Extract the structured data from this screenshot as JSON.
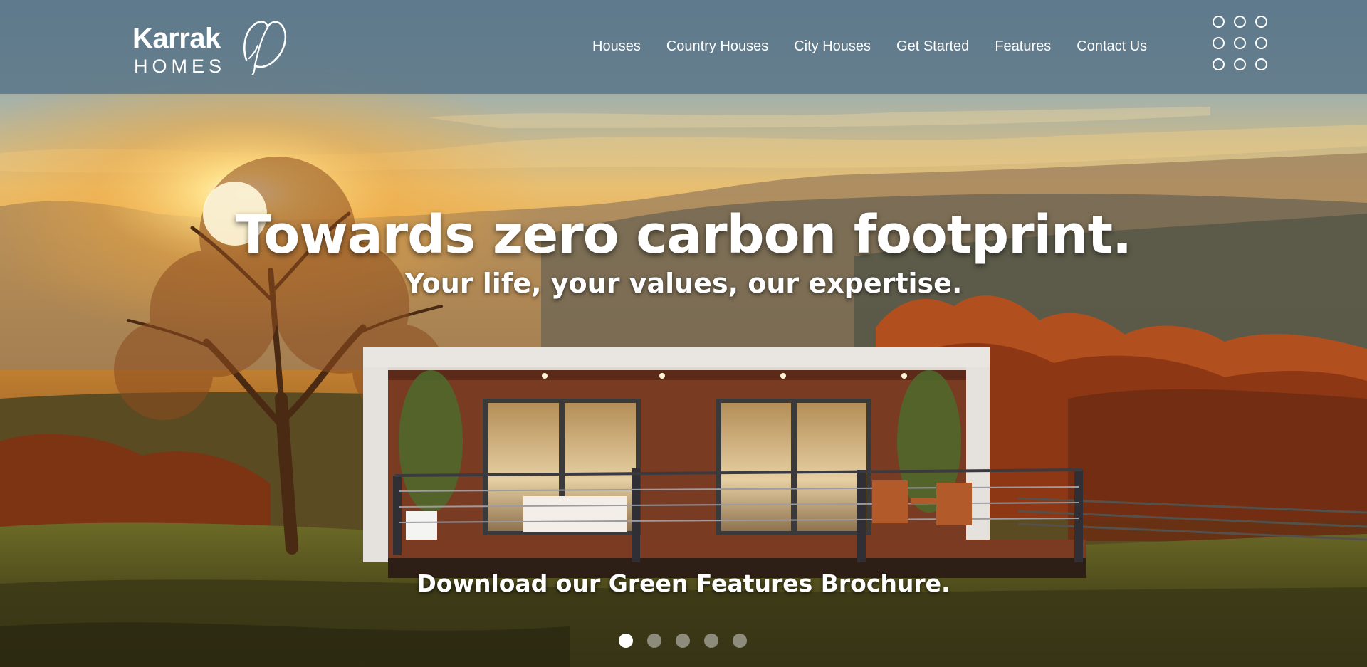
{
  "brand": {
    "logo_word": "Karrak",
    "logo_sub": "HOMES"
  },
  "nav": {
    "items": [
      {
        "label": "Houses"
      },
      {
        "label": "Country Houses"
      },
      {
        "label": "City Houses"
      },
      {
        "label": "Get Started"
      },
      {
        "label": "Features"
      },
      {
        "label": "Contact Us"
      }
    ],
    "menu_icon": "grid-dots-icon"
  },
  "hero": {
    "headline": "Towards zero carbon footprint.",
    "subhead": "Your life, your values, our expertise.",
    "cta": "Download our Green Features Brochure.",
    "slides_total": 5,
    "active_slide": 1
  },
  "colors": {
    "navbar": "#5c788a",
    "text": "#ffffff"
  }
}
